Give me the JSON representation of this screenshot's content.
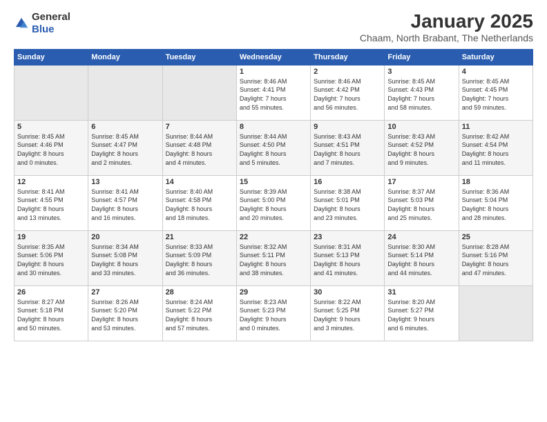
{
  "logo": {
    "general": "General",
    "blue": "Blue"
  },
  "title": "January 2025",
  "location": "Chaam, North Brabant, The Netherlands",
  "days_header": [
    "Sunday",
    "Monday",
    "Tuesday",
    "Wednesday",
    "Thursday",
    "Friday",
    "Saturday"
  ],
  "weeks": [
    [
      {
        "day": "",
        "info": ""
      },
      {
        "day": "",
        "info": ""
      },
      {
        "day": "",
        "info": ""
      },
      {
        "day": "1",
        "info": "Sunrise: 8:46 AM\nSunset: 4:41 PM\nDaylight: 7 hours\nand 55 minutes."
      },
      {
        "day": "2",
        "info": "Sunrise: 8:46 AM\nSunset: 4:42 PM\nDaylight: 7 hours\nand 56 minutes."
      },
      {
        "day": "3",
        "info": "Sunrise: 8:45 AM\nSunset: 4:43 PM\nDaylight: 7 hours\nand 58 minutes."
      },
      {
        "day": "4",
        "info": "Sunrise: 8:45 AM\nSunset: 4:45 PM\nDaylight: 7 hours\nand 59 minutes."
      }
    ],
    [
      {
        "day": "5",
        "info": "Sunrise: 8:45 AM\nSunset: 4:46 PM\nDaylight: 8 hours\nand 0 minutes."
      },
      {
        "day": "6",
        "info": "Sunrise: 8:45 AM\nSunset: 4:47 PM\nDaylight: 8 hours\nand 2 minutes."
      },
      {
        "day": "7",
        "info": "Sunrise: 8:44 AM\nSunset: 4:48 PM\nDaylight: 8 hours\nand 4 minutes."
      },
      {
        "day": "8",
        "info": "Sunrise: 8:44 AM\nSunset: 4:50 PM\nDaylight: 8 hours\nand 5 minutes."
      },
      {
        "day": "9",
        "info": "Sunrise: 8:43 AM\nSunset: 4:51 PM\nDaylight: 8 hours\nand 7 minutes."
      },
      {
        "day": "10",
        "info": "Sunrise: 8:43 AM\nSunset: 4:52 PM\nDaylight: 8 hours\nand 9 minutes."
      },
      {
        "day": "11",
        "info": "Sunrise: 8:42 AM\nSunset: 4:54 PM\nDaylight: 8 hours\nand 11 minutes."
      }
    ],
    [
      {
        "day": "12",
        "info": "Sunrise: 8:41 AM\nSunset: 4:55 PM\nDaylight: 8 hours\nand 13 minutes."
      },
      {
        "day": "13",
        "info": "Sunrise: 8:41 AM\nSunset: 4:57 PM\nDaylight: 8 hours\nand 16 minutes."
      },
      {
        "day": "14",
        "info": "Sunrise: 8:40 AM\nSunset: 4:58 PM\nDaylight: 8 hours\nand 18 minutes."
      },
      {
        "day": "15",
        "info": "Sunrise: 8:39 AM\nSunset: 5:00 PM\nDaylight: 8 hours\nand 20 minutes."
      },
      {
        "day": "16",
        "info": "Sunrise: 8:38 AM\nSunset: 5:01 PM\nDaylight: 8 hours\nand 23 minutes."
      },
      {
        "day": "17",
        "info": "Sunrise: 8:37 AM\nSunset: 5:03 PM\nDaylight: 8 hours\nand 25 minutes."
      },
      {
        "day": "18",
        "info": "Sunrise: 8:36 AM\nSunset: 5:04 PM\nDaylight: 8 hours\nand 28 minutes."
      }
    ],
    [
      {
        "day": "19",
        "info": "Sunrise: 8:35 AM\nSunset: 5:06 PM\nDaylight: 8 hours\nand 30 minutes."
      },
      {
        "day": "20",
        "info": "Sunrise: 8:34 AM\nSunset: 5:08 PM\nDaylight: 8 hours\nand 33 minutes."
      },
      {
        "day": "21",
        "info": "Sunrise: 8:33 AM\nSunset: 5:09 PM\nDaylight: 8 hours\nand 36 minutes."
      },
      {
        "day": "22",
        "info": "Sunrise: 8:32 AM\nSunset: 5:11 PM\nDaylight: 8 hours\nand 38 minutes."
      },
      {
        "day": "23",
        "info": "Sunrise: 8:31 AM\nSunset: 5:13 PM\nDaylight: 8 hours\nand 41 minutes."
      },
      {
        "day": "24",
        "info": "Sunrise: 8:30 AM\nSunset: 5:14 PM\nDaylight: 8 hours\nand 44 minutes."
      },
      {
        "day": "25",
        "info": "Sunrise: 8:28 AM\nSunset: 5:16 PM\nDaylight: 8 hours\nand 47 minutes."
      }
    ],
    [
      {
        "day": "26",
        "info": "Sunrise: 8:27 AM\nSunset: 5:18 PM\nDaylight: 8 hours\nand 50 minutes."
      },
      {
        "day": "27",
        "info": "Sunrise: 8:26 AM\nSunset: 5:20 PM\nDaylight: 8 hours\nand 53 minutes."
      },
      {
        "day": "28",
        "info": "Sunrise: 8:24 AM\nSunset: 5:22 PM\nDaylight: 8 hours\nand 57 minutes."
      },
      {
        "day": "29",
        "info": "Sunrise: 8:23 AM\nSunset: 5:23 PM\nDaylight: 9 hours\nand 0 minutes."
      },
      {
        "day": "30",
        "info": "Sunrise: 8:22 AM\nSunset: 5:25 PM\nDaylight: 9 hours\nand 3 minutes."
      },
      {
        "day": "31",
        "info": "Sunrise: 8:20 AM\nSunset: 5:27 PM\nDaylight: 9 hours\nand 6 minutes."
      },
      {
        "day": "",
        "info": ""
      }
    ]
  ]
}
